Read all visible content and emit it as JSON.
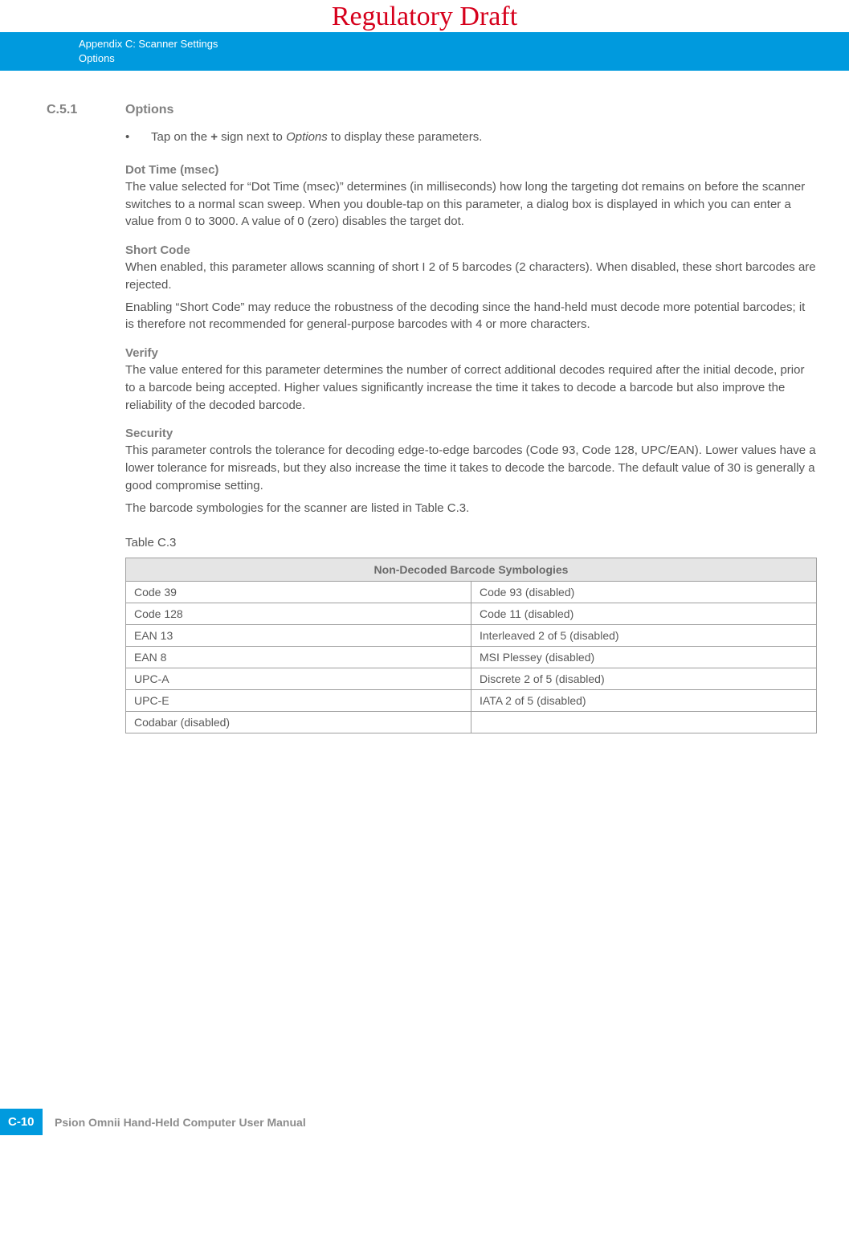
{
  "watermark": "Regulatory Draft",
  "header": {
    "line1": "Appendix C: Scanner Settings",
    "line2": "Options"
  },
  "section": {
    "number": "C.5.1",
    "title": "Options"
  },
  "bullet": {
    "prefix": "Tap on the ",
    "bold": "+",
    "mid": " sign next to ",
    "italic": "Options",
    "suffix": " to display these parameters."
  },
  "blocks": {
    "dot_time": {
      "heading": "Dot Time (msec)",
      "p1": "The value selected for “Dot Time (msec)” determines (in milliseconds) how long the targeting dot remains on before the scanner switches to a normal scan sweep. When you double-tap on this parameter, a dialog box is displayed in which you can enter a value from 0 to 3000. A value of 0 (zero) disables the target dot."
    },
    "short_code": {
      "heading": "Short Code",
      "p1": "When enabled, this parameter allows scanning of short  I 2 of 5 barcodes (2 characters). When disabled, these short barcodes are rejected.",
      "p2": "Enabling “Short Code” may reduce the robustness of the decoding since the hand-held must decode more potential barcodes; it is therefore not recommended for general-purpose barcodes with 4 or more characters."
    },
    "verify": {
      "heading": "Verify",
      "p1": "The value entered for this parameter determines the number of correct additional decodes required after the initial decode, prior to a barcode being accepted. Higher values significantly increase the time it takes to decode a barcode but also improve the reliability of the decoded barcode."
    },
    "security": {
      "heading": "Security",
      "p1": "This parameter controls the tolerance for decoding edge-to-edge barcodes (Code 93, Code 128, UPC/EAN). Lower values have a lower tolerance for misreads, but they also increase the time it takes to decode the barcode. The default value of 30 is generally a good compromise setting.",
      "p2": "The barcode symbologies for the scanner are listed in Table C.3."
    }
  },
  "table": {
    "caption": "Table C.3",
    "header": "Non-Decoded Barcode Symbologies",
    "rows": [
      {
        "left": "Code 39",
        "right": "Code 93 (disabled)"
      },
      {
        "left": "Code 128",
        "right": "Code 11 (disabled)"
      },
      {
        "left": "EAN 13",
        "right": "Interleaved 2 of 5 (disabled)"
      },
      {
        "left": "EAN 8",
        "right": "MSI Plessey (disabled)"
      },
      {
        "left": "UPC-A",
        "right": "Discrete 2 of 5 (disabled)"
      },
      {
        "left": "UPC-E",
        "right": "IATA 2 of 5 (disabled)"
      },
      {
        "left": "Codabar (disabled)",
        "right": ""
      }
    ]
  },
  "footer": {
    "page": "C-10",
    "manual": "Psion Omnii Hand-Held Computer User Manual"
  }
}
